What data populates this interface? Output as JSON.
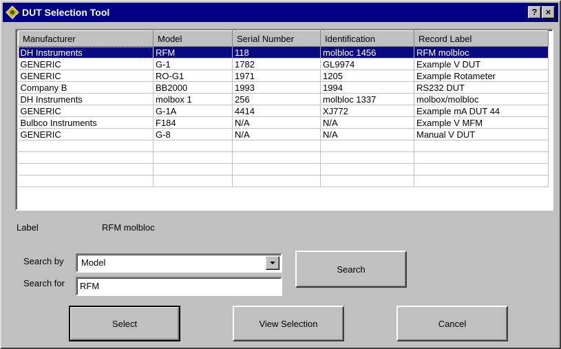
{
  "window": {
    "title": "DUT Selection Tool",
    "help_glyph": "?",
    "close_glyph": "×"
  },
  "table": {
    "columns": [
      "Manufacturer",
      "Model",
      "Serial Number",
      "Identification",
      "Record Label"
    ],
    "rows": [
      [
        "DH Instruments",
        "RFM",
        "118",
        "molbloc 1456",
        "RFM molbloc"
      ],
      [
        "GENERIC",
        "G-1",
        "1782",
        "GL9974",
        "Example V DUT"
      ],
      [
        "GENERIC",
        "RO-G1",
        "1971",
        "1205",
        "Example Rotameter"
      ],
      [
        "Company B",
        "BB2000",
        "1993",
        "1994",
        "RS232 DUT"
      ],
      [
        "DH Instruments",
        "molbox 1",
        "256",
        "molbloc 1337",
        "molbox/molbloc"
      ],
      [
        "GENERIC",
        "G-1A",
        "4414",
        "XJ772",
        "Example mA DUT 44"
      ],
      [
        "Bulbco Instruments",
        "F184",
        "N/A",
        "N/A",
        "Example V MFM"
      ],
      [
        "GENERIC",
        "G-8",
        "N/A",
        "N/A",
        "Manual V DUT"
      ]
    ],
    "selected_row": 0
  },
  "label": {
    "caption": "Label",
    "value": "RFM molbloc"
  },
  "search": {
    "by_caption": "Search by",
    "by_value": "Model",
    "for_caption": "Search for",
    "for_value": "RFM",
    "button_label": "Search"
  },
  "buttons": {
    "select": "Select",
    "view": "View Selection",
    "cancel": "Cancel"
  }
}
